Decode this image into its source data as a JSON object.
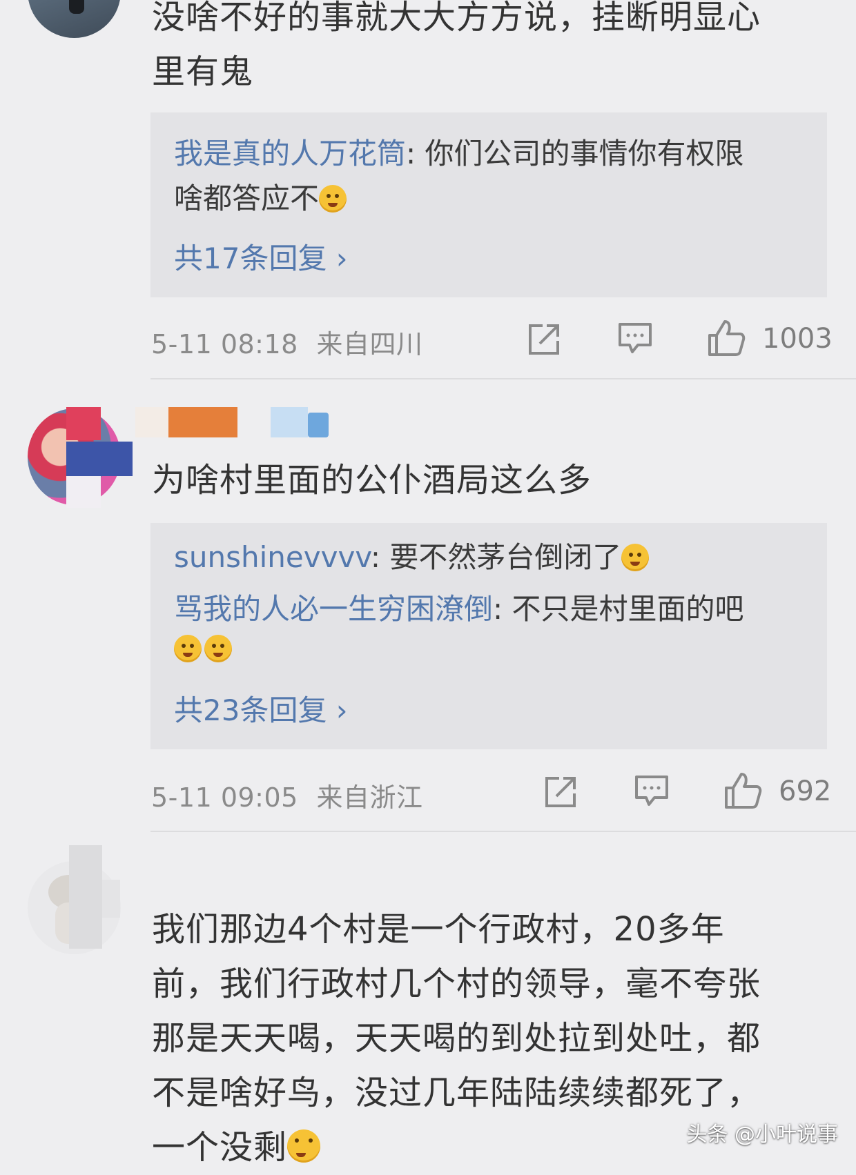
{
  "comments": [
    {
      "text_lines": [
        "没啥不好的事就大大方方说，挂断明显心",
        "里有鬼"
      ],
      "replies": [
        {
          "user": "我是真的人万花筒",
          "text_line1": ": 你们公司的事情你有权限",
          "text_line2": "啥都答应不"
        }
      ],
      "more_replies": "共17条回复 ›",
      "time": "5-11 08:18",
      "location": "来自四川",
      "likes": "1003"
    },
    {
      "text_lines": [
        "为啥村里面的公仆酒局这么多"
      ],
      "replies": [
        {
          "user": "sunshinevvvv",
          "text": ": 要不然茅台倒闭了"
        },
        {
          "user": "骂我的人必一生穷困潦倒",
          "text": ": 不只是村里面的吧"
        }
      ],
      "more_replies": "共23条回复 ›",
      "time": "5-11 09:05",
      "location": "来自浙江",
      "likes": "692"
    },
    {
      "text_lines": [
        "我们那边4个村是一个行政村，20多年",
        "前，我们行政村几个村的领导，毫不夸张",
        "那是天天喝，天天喝的到处拉到处吐，都",
        "不是啥好鸟，没过几年陆陆续续都死了，",
        "一个没剩"
      ]
    }
  ],
  "watermark": "头条 @小叶说事",
  "icons": [
    "share-icon",
    "comment-icon",
    "like-icon"
  ]
}
